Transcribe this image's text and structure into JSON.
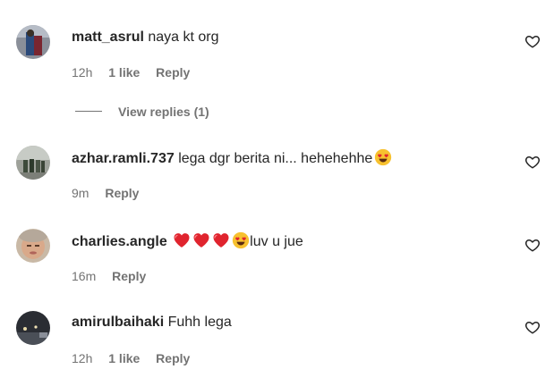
{
  "comments": [
    {
      "username": "matt_asrul",
      "text": "naya kt org",
      "time": "12h",
      "likes": "1 like",
      "reply": "Reply",
      "avatar_icon": "user-avatar"
    },
    {
      "username": "azhar.ramli.737",
      "text": "lega dgr berita ni... hehehehhe",
      "time": "9m",
      "reply": "Reply",
      "avatar_icon": "user-avatar"
    },
    {
      "username": "charlies.angle",
      "text": "luv u jue",
      "time": "16m",
      "reply": "Reply",
      "avatar_icon": "user-avatar"
    },
    {
      "username": "amirulbaihaki",
      "text": "Fuhh lega",
      "time": "12h",
      "likes": "1 like",
      "reply": "Reply",
      "avatar_icon": "user-avatar"
    }
  ],
  "view_replies": "View replies (1)",
  "icons": {
    "like": "heart-outline-icon",
    "heart_eyes": "heart-eyes-emoji",
    "red_heart": "red-heart-emoji"
  },
  "colors": {
    "text": "#262626",
    "meta": "#737373",
    "red_heart": "#e0242e",
    "emoji_face": "#f7c12f"
  }
}
